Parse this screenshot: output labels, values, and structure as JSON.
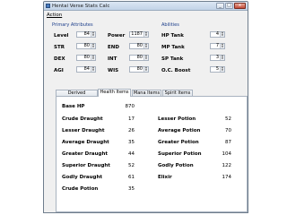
{
  "window": {
    "title": "Hentai Verse Stats Calc"
  },
  "menu": {
    "action": "Action"
  },
  "sections": {
    "primary": "Primary Attributes",
    "abilities": "Abilities"
  },
  "primary": [
    {
      "label": "Level",
      "value": "84"
    },
    {
      "label": "Power",
      "value": "1187"
    },
    {
      "label": "STR",
      "value": "80"
    },
    {
      "label": "END",
      "value": "80"
    },
    {
      "label": "DEX",
      "value": "80"
    },
    {
      "label": "INT",
      "value": "80"
    },
    {
      "label": "AGI",
      "value": "84"
    },
    {
      "label": "WIS",
      "value": "80"
    }
  ],
  "abilities": [
    {
      "label": "HP Tank",
      "value": "4"
    },
    {
      "label": "MP Tank",
      "value": "7"
    },
    {
      "label": "SP Tank",
      "value": "3"
    },
    {
      "label": "O.C. Boost",
      "value": "5"
    }
  ],
  "tabs": [
    {
      "label": "Derived Attributes",
      "active": false
    },
    {
      "label": "Health Items",
      "active": true
    },
    {
      "label": "Mana Items",
      "active": false
    },
    {
      "label": "Spirit Items",
      "active": false
    }
  ],
  "base_hp": {
    "label": "Base HP",
    "value": "870"
  },
  "items_left": [
    {
      "label": "Crude Draught",
      "value": "17"
    },
    {
      "label": "Lesser Draught",
      "value": "26"
    },
    {
      "label": "Average Draught",
      "value": "35"
    },
    {
      "label": "Greater Draught",
      "value": "44"
    },
    {
      "label": "Superior Draught",
      "value": "52"
    },
    {
      "label": "Godly Draught",
      "value": "61"
    },
    {
      "label": "Crude Potion",
      "value": "35"
    }
  ],
  "items_right": [
    {
      "label": "Lesser Potion",
      "value": "52"
    },
    {
      "label": "Average Potion",
      "value": "70"
    },
    {
      "label": "Greater Potion",
      "value": "87"
    },
    {
      "label": "Superior Potion",
      "value": "104"
    },
    {
      "label": "Godly Potion",
      "value": "122"
    },
    {
      "label": "Elixir",
      "value": "174"
    }
  ]
}
